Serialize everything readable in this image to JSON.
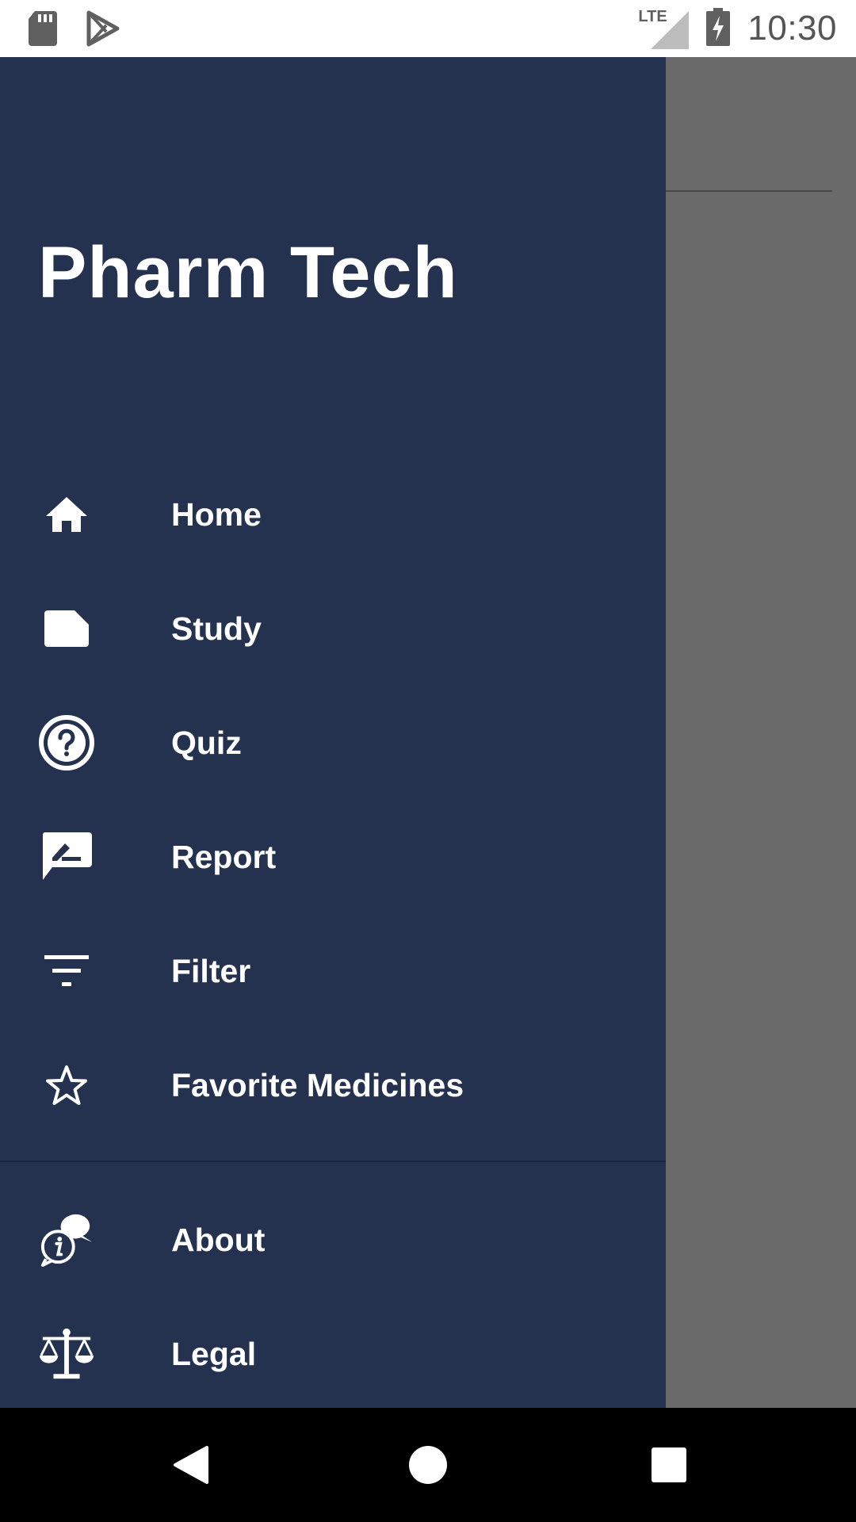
{
  "status_bar": {
    "time": "10:30",
    "network": "LTE",
    "icons": [
      "sd-card-icon",
      "play-store-icon",
      "signal-icon",
      "battery-charging-icon"
    ]
  },
  "drawer": {
    "title": "Pharm Tech",
    "items": [
      {
        "label": "Home",
        "icon": "home-icon"
      },
      {
        "label": "Study",
        "icon": "note-icon"
      },
      {
        "label": "Quiz",
        "icon": "help-circle-icon"
      },
      {
        "label": "Report",
        "icon": "rate-review-icon"
      },
      {
        "label": "Filter",
        "icon": "filter-icon"
      },
      {
        "label": "Favorite Medicines",
        "icon": "star-outline-icon"
      }
    ],
    "secondary_items": [
      {
        "label": "About",
        "icon": "info-chat-icon"
      },
      {
        "label": "Legal",
        "icon": "scales-icon"
      }
    ]
  },
  "colors": {
    "drawer_bg": "#24324f",
    "scrim": "#6a6a6a",
    "status_bar_bg": "#ffffff",
    "nav_bar_bg": "#000000"
  },
  "nav_bar": {
    "buttons": [
      "back-icon",
      "home-circle-icon",
      "recents-icon"
    ]
  }
}
